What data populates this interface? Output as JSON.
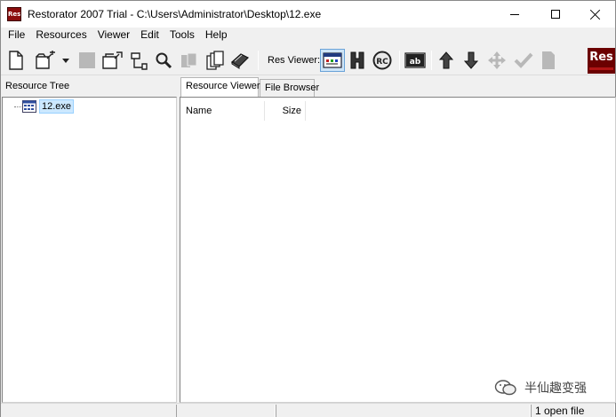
{
  "app": {
    "icon_text": "Res",
    "title": "Restorator 2007 Trial - C:\\Users\\Administrator\\Desktop\\12.exe"
  },
  "menu": [
    "File",
    "Resources",
    "Viewer",
    "Edit",
    "Tools",
    "Help"
  ],
  "toolbar": {
    "res_viewer_label": "Res Viewer:",
    "logo_text": "Res"
  },
  "left_panel": {
    "title": "Resource Tree",
    "tree": [
      {
        "label": "12.exe",
        "selected": true
      }
    ]
  },
  "right_panel": {
    "tabs": [
      {
        "label": "Resource Viewer",
        "active": true
      },
      {
        "label": "File Browser",
        "active": false
      }
    ],
    "columns": [
      "Name",
      "Size"
    ]
  },
  "watermark": {
    "text": "半仙趣变强"
  },
  "status": {
    "open_files": "1 open file"
  },
  "colors": {
    "window_bg": "#f0f0f0",
    "selection": "#cce8ff",
    "logo_red": "#6b0000"
  }
}
